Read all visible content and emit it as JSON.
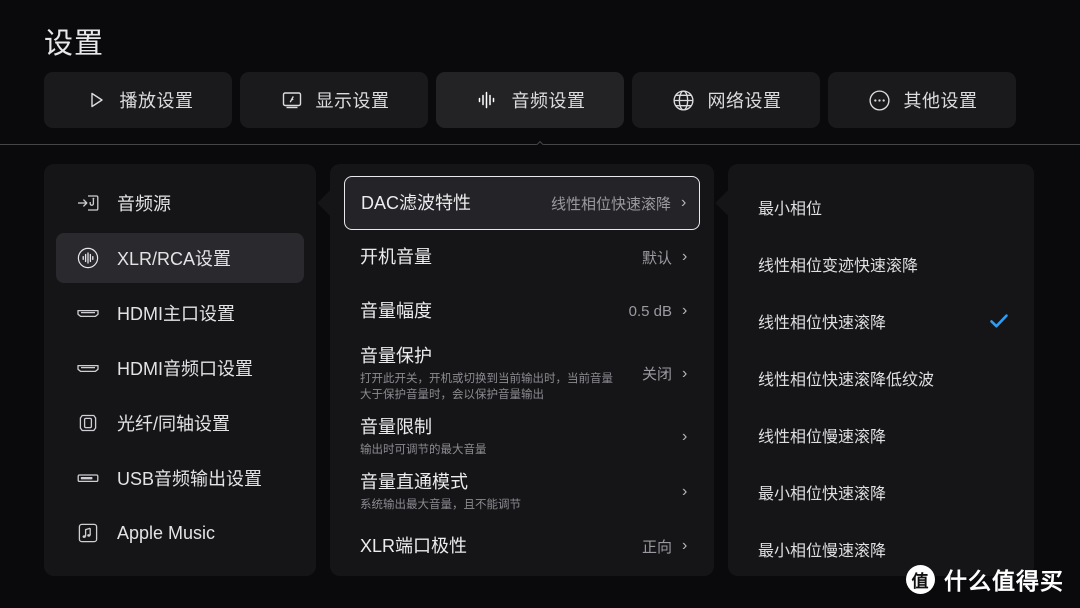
{
  "header": {
    "title": "设置",
    "tabs": [
      {
        "label": "播放设置",
        "icon": "play-icon",
        "active": false
      },
      {
        "label": "显示设置",
        "icon": "display-icon",
        "active": false
      },
      {
        "label": "音频设置",
        "icon": "audio-wave-icon",
        "active": true
      },
      {
        "label": "网络设置",
        "icon": "globe-icon",
        "active": false
      },
      {
        "label": "其他设置",
        "icon": "more-dots-icon",
        "active": false
      }
    ]
  },
  "sidebar": {
    "items": [
      {
        "label": "音频源",
        "icon": "audio-input-icon",
        "selected": false
      },
      {
        "label": "XLR/RCA设置",
        "icon": "waveform-circle-icon",
        "selected": true
      },
      {
        "label": "HDMI主口设置",
        "icon": "hdmi-port-icon",
        "selected": false
      },
      {
        "label": "HDMI音频口设置",
        "icon": "hdmi-port-icon",
        "selected": false
      },
      {
        "label": "光纤/同轴设置",
        "icon": "optical-port-icon",
        "selected": false
      },
      {
        "label": "USB音频输出设置",
        "icon": "usb-port-icon",
        "selected": false
      },
      {
        "label": "Apple Music",
        "icon": "music-note-icon",
        "selected": false
      }
    ]
  },
  "middle": {
    "rows": [
      {
        "title": "DAC滤波特性",
        "sub": "",
        "value": "线性相位快速滚降",
        "chevron": "›",
        "highlight": true
      },
      {
        "title": "开机音量",
        "sub": "",
        "value": "默认",
        "chevron": "›",
        "highlight": false
      },
      {
        "title": "音量幅度",
        "sub": "",
        "value": "0.5 dB",
        "chevron": "›",
        "highlight": false
      },
      {
        "title": "音量保护",
        "sub": "打开此开关，开机或切换到当前输出时，当前音量大于保护音量时，会以保护音量输出",
        "value": "关闭",
        "chevron": "›",
        "highlight": false
      },
      {
        "title": "音量限制",
        "sub": "输出时可调节的最大音量",
        "value": "",
        "chevron": "›",
        "highlight": false
      },
      {
        "title": "音量直通模式",
        "sub": "系统输出最大音量，且不能调节",
        "value": "",
        "chevron": "›",
        "highlight": false
      },
      {
        "title": "XLR端口极性",
        "sub": "",
        "value": "正向",
        "chevron": "›",
        "highlight": false
      }
    ]
  },
  "right": {
    "options": [
      {
        "label": "最小相位",
        "checked": false
      },
      {
        "label": "线性相位变迹快速滚降",
        "checked": false
      },
      {
        "label": "线性相位快速滚降",
        "checked": true
      },
      {
        "label": "线性相位快速滚降低纹波",
        "checked": false
      },
      {
        "label": "线性相位慢速滚降",
        "checked": false
      },
      {
        "label": "最小相位快速滚降",
        "checked": false
      },
      {
        "label": "最小相位慢速滚降",
        "checked": false
      }
    ],
    "check_glyph": "✔"
  },
  "watermark": {
    "logo_text": "值",
    "label": "什么值得买"
  },
  "colors": {
    "background": "#0a0a0c",
    "panel": "#151518",
    "panel_selected": "#2a2a2e",
    "accent_check": "#2e9bf5",
    "text_primary": "#ececee",
    "text_secondary": "#8b8b90"
  }
}
